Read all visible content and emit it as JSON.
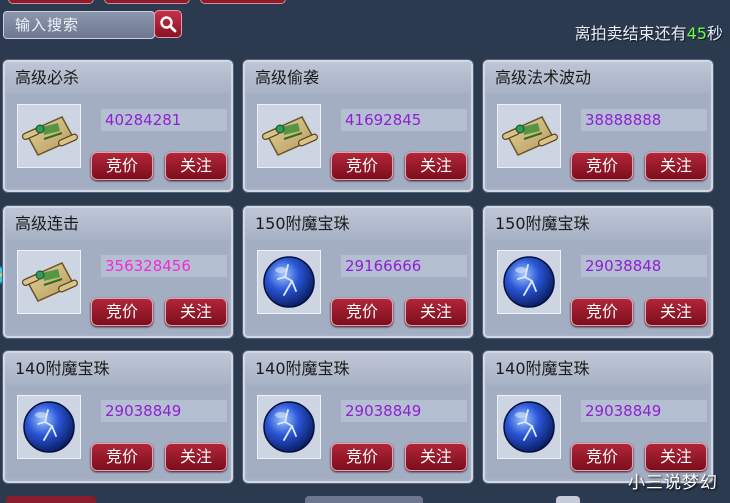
{
  "search": {
    "placeholder": "输入搜索"
  },
  "countdown": {
    "prefix": "离拍卖结束还有",
    "seconds": "45",
    "suffix": "秒"
  },
  "buttons": {
    "bid": "竞价",
    "watch": "关注"
  },
  "cards": [
    {
      "name": "高级必杀",
      "price": "40284281",
      "icon": "scroll-icon",
      "highlight": false
    },
    {
      "name": "高级偷袭",
      "price": "41692845",
      "icon": "scroll-icon",
      "highlight": false
    },
    {
      "name": "高级法术波动",
      "price": "38888888",
      "icon": "scroll-icon",
      "highlight": false
    },
    {
      "name": "高级连击",
      "price": "356328456",
      "icon": "scroll-icon",
      "highlight": true
    },
    {
      "name": "150附魔宝珠",
      "price": "29166666",
      "icon": "orb-icon",
      "highlight": false
    },
    {
      "name": "150附魔宝珠",
      "price": "29038848",
      "icon": "orb-icon",
      "highlight": false
    },
    {
      "name": "140附魔宝珠",
      "price": "29038849",
      "icon": "orb-icon",
      "highlight": false
    },
    {
      "name": "140附魔宝珠",
      "price": "29038849",
      "icon": "orb-icon",
      "highlight": false
    },
    {
      "name": "140附魔宝珠",
      "price": "29038849",
      "icon": "orb-icon",
      "highlight": false
    }
  ],
  "watermark": "小三说梦幻",
  "colors": {
    "price": "#8e1fd6",
    "price_highlight": "#f02bd8",
    "button": "#9a1a2e",
    "seconds": "#66ff44"
  }
}
